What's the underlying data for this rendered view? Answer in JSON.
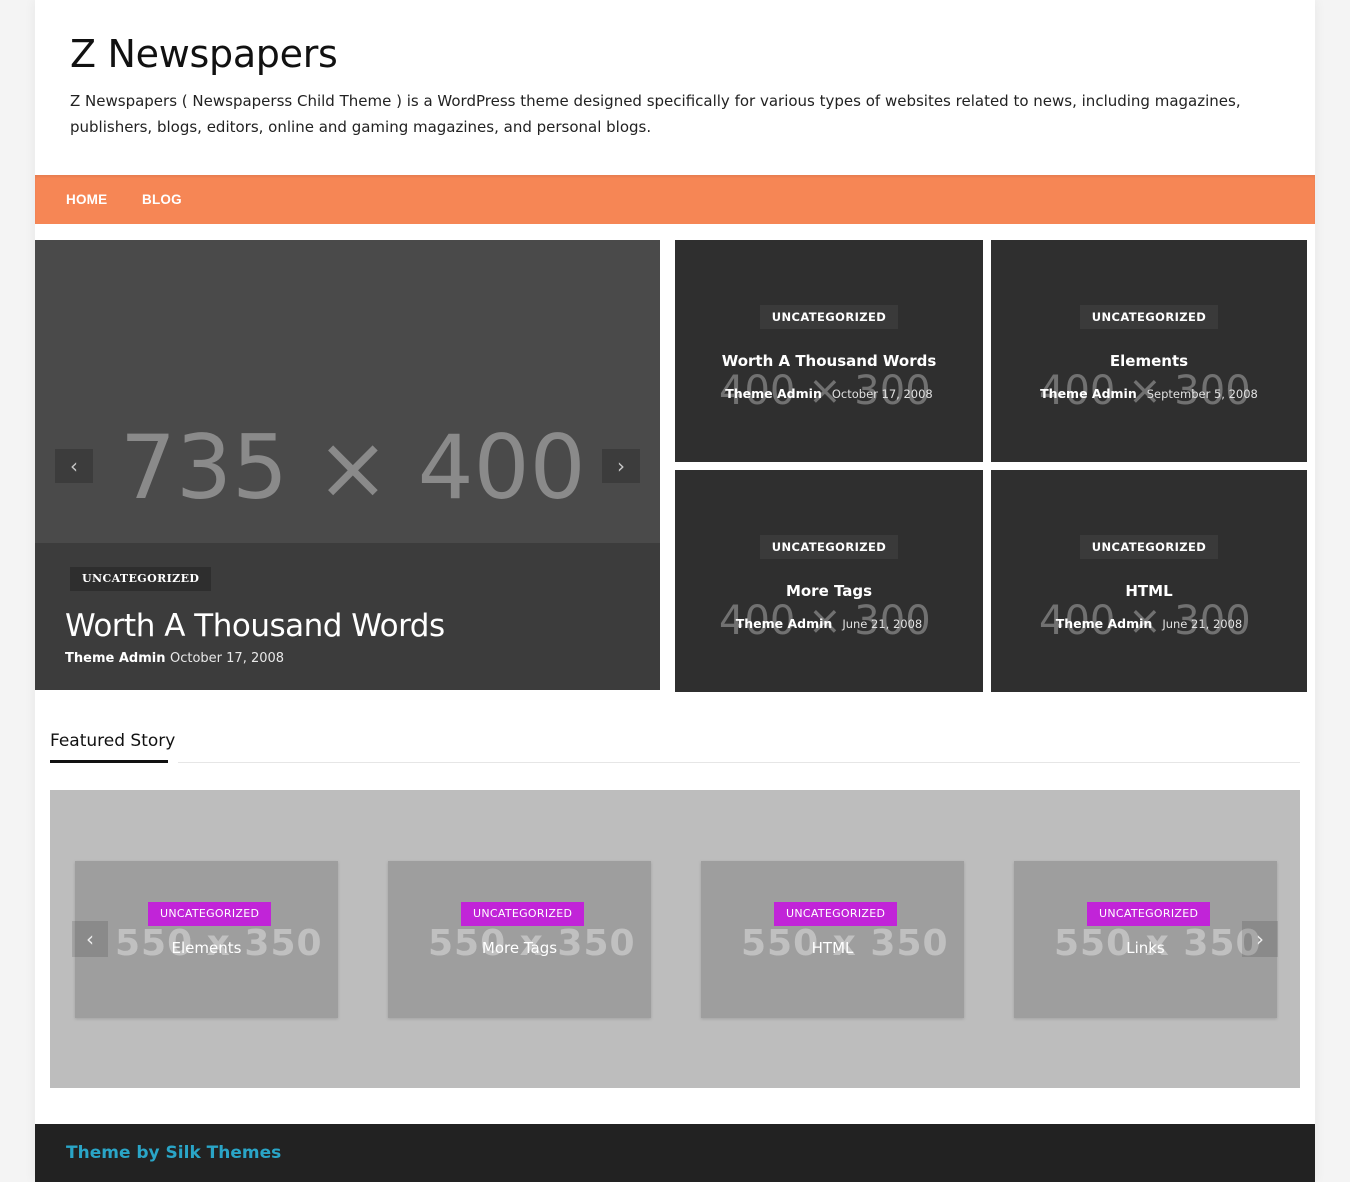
{
  "site": {
    "title": "Z Newspapers",
    "description": "Z Newspapers ( Newspaperss Child Theme ) is a WordPress theme designed specifically for various types of websites related to news, including magazines, publishers, blogs, editors, online and gaming magazines, and personal blogs."
  },
  "nav": {
    "items": [
      {
        "label": "HOME"
      },
      {
        "label": "BLOG"
      }
    ],
    "color": "#f68655"
  },
  "slider": {
    "placeholder": "735 × 400",
    "category": "UNCATEGORIZED",
    "title": "Worth A Thousand Words",
    "author": "Theme Admin",
    "date": "October 17, 2008",
    "prev_icon": "chevron-left-icon",
    "next_icon": "chevron-right-icon"
  },
  "tiles": [
    {
      "category": "UNCATEGORIZED",
      "title": "Worth A Thousand Words",
      "author": "Theme Admin",
      "date": "October 17, 2008",
      "placeholder": "400 × 300"
    },
    {
      "category": "UNCATEGORIZED",
      "title": "Elements",
      "author": "Theme Admin",
      "date": "September 5, 2008",
      "placeholder": "400 × 300"
    },
    {
      "category": "UNCATEGORIZED",
      "title": "More Tags",
      "author": "Theme Admin",
      "date": "June 21, 2008",
      "placeholder": "400 × 300"
    },
    {
      "category": "UNCATEGORIZED",
      "title": "HTML",
      "author": "Theme Admin",
      "date": "June 21, 2008",
      "placeholder": "400 × 300"
    }
  ],
  "featured": {
    "heading": "Featured Story",
    "cards": [
      {
        "category": "UNCATEGORIZED",
        "title": "Elements",
        "placeholder": "550 x 350"
      },
      {
        "category": "UNCATEGORIZED",
        "title": "More Tags",
        "placeholder": "550 x 350"
      },
      {
        "category": "UNCATEGORIZED",
        "title": "HTML",
        "placeholder": "550 x 350"
      },
      {
        "category": "UNCATEGORIZED",
        "title": "Links",
        "placeholder": "550 x 350"
      }
    ],
    "badge_color": "#c124d8"
  },
  "footer": {
    "credit": "Theme by Silk Themes",
    "link_color": "#2aa5c7"
  }
}
